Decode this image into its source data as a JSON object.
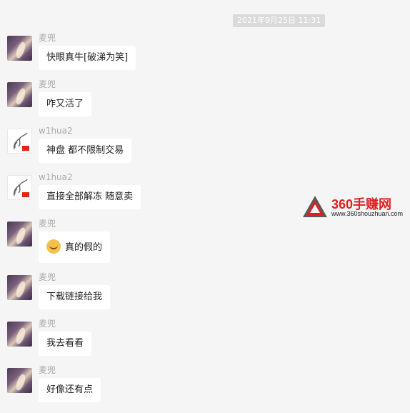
{
  "timestamp": "2021年9月25日 11:31",
  "messages": [
    {
      "sender": "麦兜",
      "text": "快眼真牛[破涕为笑]"
    },
    {
      "sender": "麦兜",
      "text": "咋又活了"
    },
    {
      "sender": "w1hua2",
      "text": "神盘 都不限制交易"
    },
    {
      "sender": "w1hua2",
      "text": "直接全部解冻 随意卖"
    },
    {
      "sender": "麦兜",
      "text": "真的假的",
      "emoji": "tears-of-joy-emoji"
    },
    {
      "sender": "麦兜",
      "text": "下载链接给我"
    },
    {
      "sender": "麦兜",
      "text": "我去看看"
    },
    {
      "sender": "麦兜",
      "text": "好像还有点"
    }
  ],
  "watermark": {
    "title": "360手赚网",
    "url": "www.360shouzhuan.com"
  },
  "colors": {
    "background": "#f5f5f5",
    "bubble": "#ffffff",
    "sender_name": "#aaaaaa",
    "watermark_red": "#e02020"
  }
}
